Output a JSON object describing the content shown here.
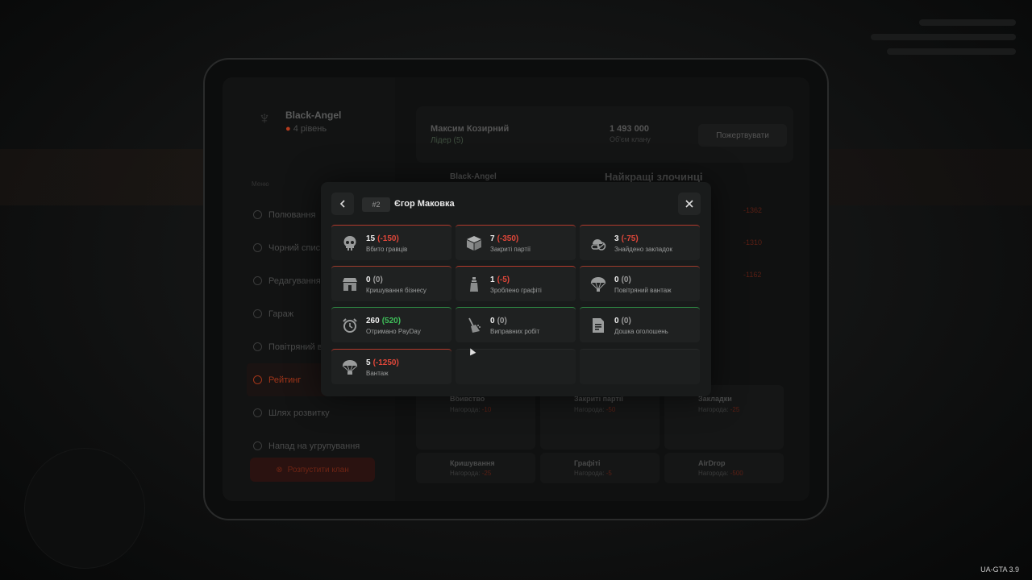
{
  "background": {
    "clan": {
      "name": "Black-Angel",
      "level": "4 рівень"
    },
    "menu_title": "Меню",
    "menu_items": [
      {
        "label": "Полювання"
      },
      {
        "label": "Чорний спис"
      },
      {
        "label": "Редагування"
      },
      {
        "label": "Гараж"
      },
      {
        "label": "Повітряний в"
      },
      {
        "label": "Рейтинг"
      },
      {
        "label": "Шлях розвитку"
      },
      {
        "label": "Напад на угрупування"
      }
    ],
    "dissolve_label": "Розпустити клан",
    "leader": {
      "name": "Максим Козирний",
      "role": "Лідер (5)"
    },
    "money": {
      "amount": "1 493 000",
      "label": "Об'єм клану"
    },
    "donate_label": "Пожертвувати",
    "top_title": "Найкращі злочинці",
    "top_clan": "Black-Angel",
    "top_values": [
      "-1362",
      "-1310",
      "-1162"
    ],
    "cards_top": [
      {
        "title": "Вбивство",
        "sub_prefix": "Нагорода:",
        "sub_value": "-10"
      },
      {
        "title": "Закриті партії",
        "sub_prefix": "Нагорода:",
        "sub_value": "-50"
      },
      {
        "title": "Закладки",
        "sub_prefix": "Нагорода:",
        "sub_value": "-25"
      }
    ],
    "cards_bottom": [
      {
        "title": "Кришування",
        "sub_prefix": "Нагорода:",
        "sub_value": "-25"
      },
      {
        "title": "Графіті",
        "sub_prefix": "Нагорода:",
        "sub_value": "-5"
      },
      {
        "title": "AirDrop",
        "sub_prefix": "Нагорода:",
        "sub_value": "-500"
      }
    ]
  },
  "modal": {
    "rank": "#2",
    "player_name": "Єгор Маковка",
    "back_icon": "chevron-left-icon",
    "close_icon": "close-icon",
    "stats": [
      {
        "value": "15",
        "delta": "(-150)",
        "delta_tone": "r",
        "label": "Вбито гравців",
        "icon": "skull-icon",
        "tone": "neg"
      },
      {
        "value": "7",
        "delta": "(-350)",
        "delta_tone": "r",
        "label": "Закриті партії",
        "icon": "box-icon",
        "tone": "neg"
      },
      {
        "value": "3",
        "delta": "(-75)",
        "delta_tone": "r",
        "label": "Знайдено закладок",
        "icon": "pills-icon",
        "tone": "neg"
      },
      {
        "value": "0",
        "delta": "(0)",
        "delta_tone": "z",
        "label": "Кришування бізнесу",
        "icon": "shop-icon",
        "tone": "neu"
      },
      {
        "value": "1",
        "delta": "(-5)",
        "delta_tone": "r",
        "label": "Зроблено графіті",
        "icon": "spray-icon",
        "tone": "neg"
      },
      {
        "value": "0",
        "delta": "(0)",
        "delta_tone": "z",
        "label": "Повітряний вантаж",
        "icon": "parachute-icon",
        "tone": "neu"
      },
      {
        "value": "260",
        "delta": "(520)",
        "delta_tone": "g",
        "label": "Отримано PayDay",
        "icon": "alarm-clock-icon",
        "tone": "pos"
      },
      {
        "value": "0",
        "delta": "(0)",
        "delta_tone": "z",
        "label": "Виправних робіт",
        "icon": "broom-icon",
        "tone": "pos"
      },
      {
        "value": "0",
        "delta": "(0)",
        "delta_tone": "z",
        "label": "Дошка оголошень",
        "icon": "notice-board-icon",
        "tone": "pos"
      },
      {
        "value": "5",
        "delta": "(-1250)",
        "delta_tone": "r",
        "label": "Вантаж",
        "icon": "parachute-icon",
        "tone": "neg"
      }
    ]
  },
  "version": "UA-GTA 3.9"
}
